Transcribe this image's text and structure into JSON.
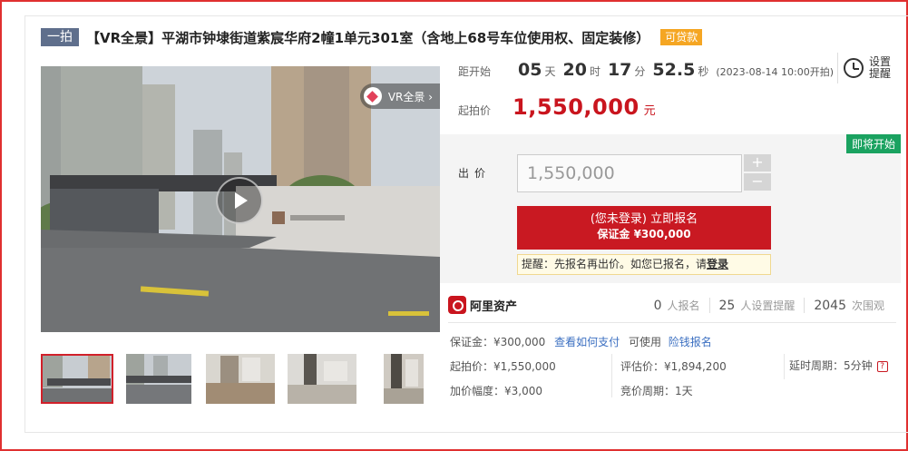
{
  "header": {
    "tag": "一拍",
    "title": "【VR全景】平湖市钟埭街道紫宸华府2幢1单元301室（含地上68号车位使用权、固定装修）",
    "loan_badge": "可贷款"
  },
  "media": {
    "vr_label": "VR全景 ›",
    "thumbnail_count": 5,
    "active_thumbnail": 1
  },
  "countdown": {
    "label": "距开始",
    "days": "05",
    "days_unit": "天",
    "hours": "20",
    "hours_unit": "时",
    "minutes": "17",
    "minutes_unit": "分",
    "seconds": "52.5",
    "seconds_unit": "秒",
    "start_time": "(2023-08-14 10:00开拍)",
    "remind_label": "设置提醒"
  },
  "starting": {
    "label": "起拍价",
    "price": "1,550,000",
    "unit": "元"
  },
  "bid": {
    "status_badge": "即将开始",
    "label": "出价",
    "value": "1,550,000",
    "plus": "+",
    "minus": "−",
    "signup_main": "(您未登录) 立即报名",
    "signup_sub": "保证金 ¥300,000",
    "tip_text": "提醒：先报名再出价。如您已报名，请",
    "tip_link": "登录"
  },
  "platform": {
    "logo_text": "阿里资产",
    "signups": "0",
    "signups_label": "人报名",
    "reminders": "25",
    "reminders_label": "人设置提醒",
    "views": "2045",
    "views_label": "次围观"
  },
  "details": {
    "deposit": "保证金：¥300,000",
    "how_pay": "查看如何支付",
    "usable": "可使用",
    "insurance": "险钱报名",
    "start_price": "起拍价：¥1,550,000",
    "increment": "加价幅度：¥3,000",
    "appraisal": "评估价：¥1,894,200",
    "bid_cycle": "竞价周期：1天",
    "delay_cycle": "延时周期：5分钟"
  }
}
